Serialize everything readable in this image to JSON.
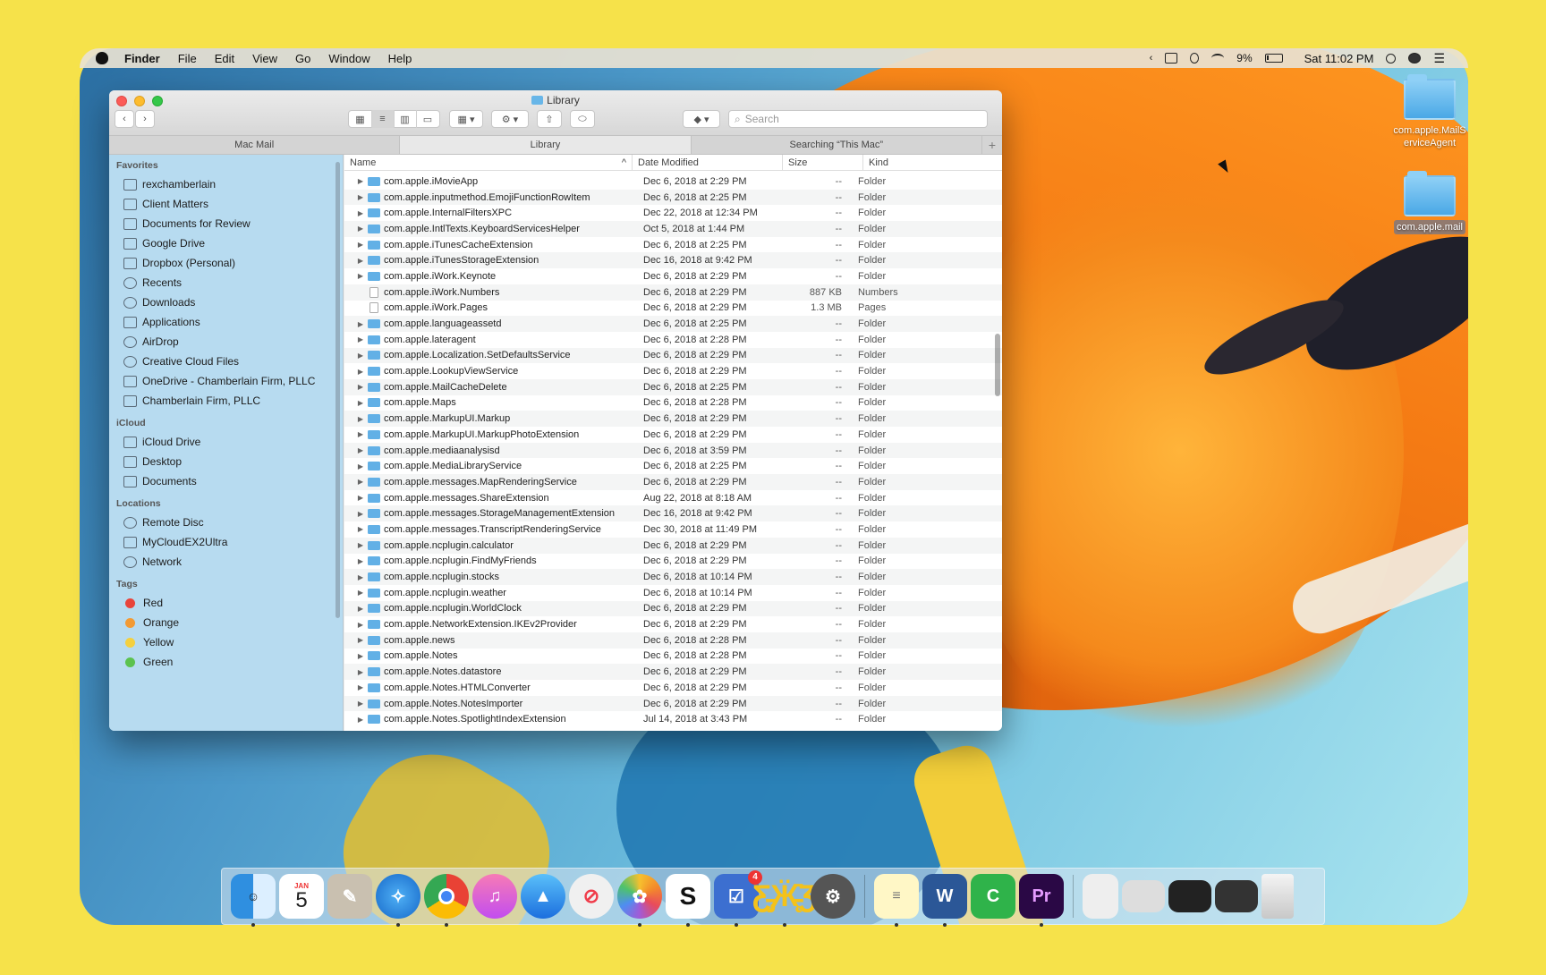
{
  "menubar": {
    "app": "Finder",
    "items": [
      "File",
      "Edit",
      "View",
      "Go",
      "Window",
      "Help"
    ],
    "battery": "9%",
    "clock": "Sat 11:02 PM"
  },
  "window": {
    "title": "Library",
    "search_placeholder": "Search",
    "tabs": [
      "Mac Mail",
      "Library",
      "Searching “This Mac”"
    ],
    "columns": {
      "name": "Name",
      "date": "Date Modified",
      "size": "Size",
      "kind": "Kind"
    }
  },
  "sidebar": {
    "favorites_header": "Favorites",
    "favorites": [
      "rexchamberlain",
      "Client Matters",
      "Documents for Review",
      "Google Drive",
      "Dropbox (Personal)",
      "Recents",
      "Downloads",
      "Applications",
      "AirDrop",
      "Creative Cloud Files",
      "OneDrive - Chamberlain Firm, PLLC",
      "Chamberlain Firm, PLLC"
    ],
    "icloud_header": "iCloud",
    "icloud": [
      "iCloud Drive",
      "Desktop",
      "Documents"
    ],
    "locations_header": "Locations",
    "locations": [
      "Remote Disc",
      "MyCloudEX2Ultra",
      "Network"
    ],
    "tags_header": "Tags",
    "tags": [
      {
        "name": "Red",
        "color": "#e8443a"
      },
      {
        "name": "Orange",
        "color": "#f29a34"
      },
      {
        "name": "Yellow",
        "color": "#f4d03f"
      },
      {
        "name": "Green",
        "color": "#5cc24e"
      }
    ]
  },
  "rows": [
    {
      "name": "com.apple.iMovieApp",
      "date": "Dec 6, 2018 at 2:29 PM",
      "size": "--",
      "kind": "Folder",
      "folder": true
    },
    {
      "name": "com.apple.inputmethod.EmojiFunctionRowItem",
      "date": "Dec 6, 2018 at 2:25 PM",
      "size": "--",
      "kind": "Folder",
      "folder": true
    },
    {
      "name": "com.apple.InternalFiltersXPC",
      "date": "Dec 22, 2018 at 12:34 PM",
      "size": "--",
      "kind": "Folder",
      "folder": true
    },
    {
      "name": "com.apple.IntlTexts.KeyboardServicesHelper",
      "date": "Oct 5, 2018 at 1:44 PM",
      "size": "--",
      "kind": "Folder",
      "folder": true
    },
    {
      "name": "com.apple.iTunesCacheExtension",
      "date": "Dec 6, 2018 at 2:25 PM",
      "size": "--",
      "kind": "Folder",
      "folder": true
    },
    {
      "name": "com.apple.iTunesStorageExtension",
      "date": "Dec 16, 2018 at 9:42 PM",
      "size": "--",
      "kind": "Folder",
      "folder": true
    },
    {
      "name": "com.apple.iWork.Keynote",
      "date": "Dec 6, 2018 at 2:29 PM",
      "size": "--",
      "kind": "Folder",
      "folder": true
    },
    {
      "name": "com.apple.iWork.Numbers",
      "date": "Dec 6, 2018 at 2:29 PM",
      "size": "887 KB",
      "kind": "Numbers",
      "folder": false
    },
    {
      "name": "com.apple.iWork.Pages",
      "date": "Dec 6, 2018 at 2:29 PM",
      "size": "1.3 MB",
      "kind": "Pages",
      "folder": false
    },
    {
      "name": "com.apple.languageassetd",
      "date": "Dec 6, 2018 at 2:25 PM",
      "size": "--",
      "kind": "Folder",
      "folder": true
    },
    {
      "name": "com.apple.lateragent",
      "date": "Dec 6, 2018 at 2:28 PM",
      "size": "--",
      "kind": "Folder",
      "folder": true
    },
    {
      "name": "com.apple.Localization.SetDefaultsService",
      "date": "Dec 6, 2018 at 2:29 PM",
      "size": "--",
      "kind": "Folder",
      "folder": true
    },
    {
      "name": "com.apple.LookupViewService",
      "date": "Dec 6, 2018 at 2:29 PM",
      "size": "--",
      "kind": "Folder",
      "folder": true
    },
    {
      "name": "com.apple.MailCacheDelete",
      "date": "Dec 6, 2018 at 2:25 PM",
      "size": "--",
      "kind": "Folder",
      "folder": true
    },
    {
      "name": "com.apple.Maps",
      "date": "Dec 6, 2018 at 2:28 PM",
      "size": "--",
      "kind": "Folder",
      "folder": true
    },
    {
      "name": "com.apple.MarkupUI.Markup",
      "date": "Dec 6, 2018 at 2:29 PM",
      "size": "--",
      "kind": "Folder",
      "folder": true
    },
    {
      "name": "com.apple.MarkupUI.MarkupPhotoExtension",
      "date": "Dec 6, 2018 at 2:29 PM",
      "size": "--",
      "kind": "Folder",
      "folder": true
    },
    {
      "name": "com.apple.mediaanalysisd",
      "date": "Dec 6, 2018 at 3:59 PM",
      "size": "--",
      "kind": "Folder",
      "folder": true
    },
    {
      "name": "com.apple.MediaLibraryService",
      "date": "Dec 6, 2018 at 2:25 PM",
      "size": "--",
      "kind": "Folder",
      "folder": true
    },
    {
      "name": "com.apple.messages.MapRenderingService",
      "date": "Dec 6, 2018 at 2:29 PM",
      "size": "--",
      "kind": "Folder",
      "folder": true
    },
    {
      "name": "com.apple.messages.ShareExtension",
      "date": "Aug 22, 2018 at 8:18 AM",
      "size": "--",
      "kind": "Folder",
      "folder": true
    },
    {
      "name": "com.apple.messages.StorageManagementExtension",
      "date": "Dec 16, 2018 at 9:42 PM",
      "size": "--",
      "kind": "Folder",
      "folder": true
    },
    {
      "name": "com.apple.messages.TranscriptRenderingService",
      "date": "Dec 30, 2018 at 11:49 PM",
      "size": "--",
      "kind": "Folder",
      "folder": true
    },
    {
      "name": "com.apple.ncplugin.calculator",
      "date": "Dec 6, 2018 at 2:29 PM",
      "size": "--",
      "kind": "Folder",
      "folder": true
    },
    {
      "name": "com.apple.ncplugin.FindMyFriends",
      "date": "Dec 6, 2018 at 2:29 PM",
      "size": "--",
      "kind": "Folder",
      "folder": true
    },
    {
      "name": "com.apple.ncplugin.stocks",
      "date": "Dec 6, 2018 at 10:14 PM",
      "size": "--",
      "kind": "Folder",
      "folder": true
    },
    {
      "name": "com.apple.ncplugin.weather",
      "date": "Dec 6, 2018 at 10:14 PM",
      "size": "--",
      "kind": "Folder",
      "folder": true
    },
    {
      "name": "com.apple.ncplugin.WorldClock",
      "date": "Dec 6, 2018 at 2:29 PM",
      "size": "--",
      "kind": "Folder",
      "folder": true
    },
    {
      "name": "com.apple.NetworkExtension.IKEv2Provider",
      "date": "Dec 6, 2018 at 2:29 PM",
      "size": "--",
      "kind": "Folder",
      "folder": true
    },
    {
      "name": "com.apple.news",
      "date": "Dec 6, 2018 at 2:28 PM",
      "size": "--",
      "kind": "Folder",
      "folder": true
    },
    {
      "name": "com.apple.Notes",
      "date": "Dec 6, 2018 at 2:28 PM",
      "size": "--",
      "kind": "Folder",
      "folder": true
    },
    {
      "name": "com.apple.Notes.datastore",
      "date": "Dec 6, 2018 at 2:29 PM",
      "size": "--",
      "kind": "Folder",
      "folder": true
    },
    {
      "name": "com.apple.Notes.HTMLConverter",
      "date": "Dec 6, 2018 at 2:29 PM",
      "size": "--",
      "kind": "Folder",
      "folder": true
    },
    {
      "name": "com.apple.Notes.NotesImporter",
      "date": "Dec 6, 2018 at 2:29 PM",
      "size": "--",
      "kind": "Folder",
      "folder": true
    },
    {
      "name": "com.apple.Notes.SpotlightIndexExtension",
      "date": "Jul 14, 2018 at 3:43 PM",
      "size": "--",
      "kind": "Folder",
      "folder": true
    }
  ],
  "desktop": [
    {
      "label": "com.apple.MailServiceAgent"
    },
    {
      "label": "com.apple.mail"
    }
  ],
  "dock": {
    "calendar_month": "JAN",
    "calendar_day": "5",
    "reminders_badge": "4",
    "apps": [
      "finder-icon",
      "calendar-icon",
      "preview-icon",
      "safari-icon",
      "chrome-icon",
      "itunes-icon",
      "testflight-icon",
      "news-icon",
      "photos-icon",
      "scrivener-icon",
      "things-icon",
      "tes-icon",
      "system-preferences-icon",
      "notes-icon",
      "word-icon",
      "numbers-icon",
      "premiere-icon"
    ]
  }
}
